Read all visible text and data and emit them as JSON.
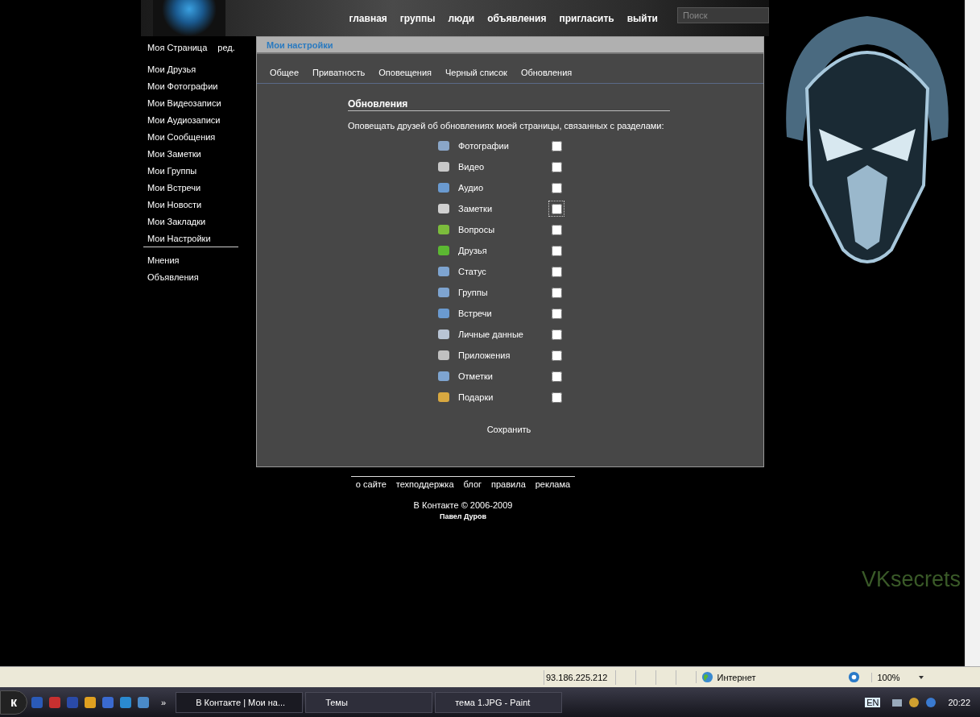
{
  "nav": {
    "links": [
      "главная",
      "группы",
      "люди",
      "объявления",
      "пригласить",
      "выйти"
    ],
    "search": {
      "placeholder": "Поиск"
    }
  },
  "sidebar": {
    "profile": "Моя Страница",
    "edit": "ред.",
    "items": [
      "Мои Друзья",
      "Мои Фотографии",
      "Мои Видеозаписи",
      "Мои Аудиозаписи",
      "Мои Сообщения",
      "Мои Заметки",
      "Мои Группы",
      "Мои Встречи",
      "Мои Новости",
      "Мои Закладки",
      "Мои Настройки"
    ],
    "extra": [
      "Мнения",
      "Объявления"
    ]
  },
  "panel": {
    "title": "Мои настройки",
    "tabs": [
      "Общее",
      "Приватность",
      "Оповещения",
      "Черный список",
      "Обновления"
    ],
    "heading": "Обновления",
    "description": "Оповещать друзей об обновлениях моей страницы, связанных с разделами:",
    "options": [
      {
        "label": "Фотографии",
        "checked": false,
        "focused": false
      },
      {
        "label": "Видео",
        "checked": false,
        "focused": false
      },
      {
        "label": "Аудио",
        "checked": false,
        "focused": false
      },
      {
        "label": "Заметки",
        "checked": false,
        "focused": true
      },
      {
        "label": "Вопросы",
        "checked": false,
        "focused": false
      },
      {
        "label": "Друзья",
        "checked": false,
        "focused": false
      },
      {
        "label": "Статус",
        "checked": false,
        "focused": false
      },
      {
        "label": "Группы",
        "checked": false,
        "focused": false
      },
      {
        "label": "Встречи",
        "checked": false,
        "focused": false
      },
      {
        "label": "Личные данные",
        "checked": false,
        "focused": false
      },
      {
        "label": "Приложения",
        "checked": false,
        "focused": false
      },
      {
        "label": "Отметки",
        "checked": false,
        "focused": false
      },
      {
        "label": "Подарки",
        "checked": false,
        "focused": false
      }
    ],
    "save": "Сохранить"
  },
  "footer": {
    "links": [
      "о сайте",
      "техподдержка",
      "блог",
      "правила",
      "реклама"
    ],
    "copyright": "В Контакте © 2006-2009",
    "author": "Павел Дуров"
  },
  "theme_logo": "VKsecrets",
  "status_bar": {
    "address": "93.186.225.212",
    "zone": "Интернет",
    "zoom": "100%"
  },
  "taskbar": {
    "start": "к",
    "overflow": "»",
    "tasks": [
      {
        "label": "В Контакте | Мои на...",
        "selected": true
      },
      {
        "label": "Темы",
        "selected": false
      },
      {
        "label": "тема 1.JPG - Paint",
        "selected": false
      }
    ],
    "language": "EN",
    "clock": "20:22"
  }
}
